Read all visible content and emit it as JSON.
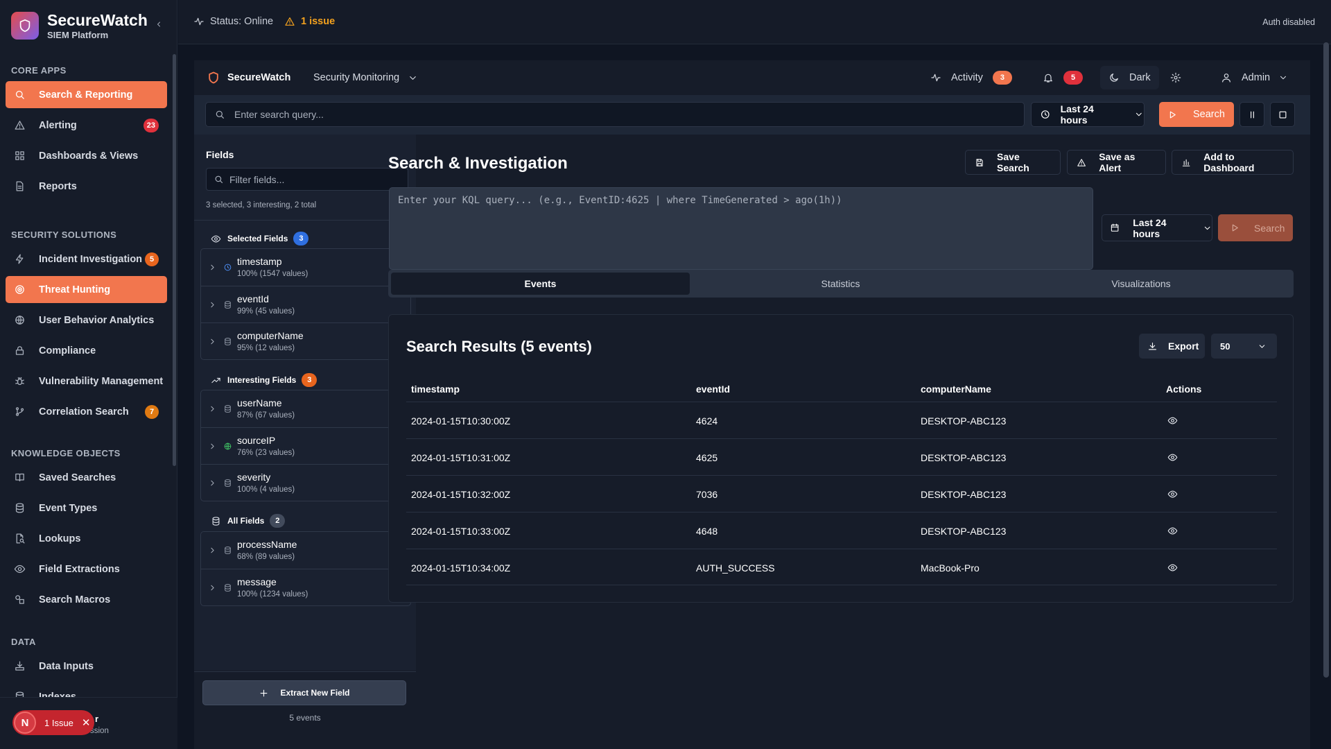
{
  "sidebar": {
    "brand_title": "SecureWatch",
    "brand_subtitle": "SIEM Platform",
    "sections": {
      "core": "CORE APPS",
      "security": "SECURITY SOLUTIONS",
      "knowledge": "KNOWLEDGE OBJECTS",
      "data": "DATA"
    },
    "items": [
      {
        "label": "Search & Reporting",
        "icon": "search-icon"
      },
      {
        "label": "Alerting",
        "icon": "alert-triangle-icon",
        "badge": "23"
      },
      {
        "label": "Dashboards & Views",
        "icon": "grid-icon"
      },
      {
        "label": "Reports",
        "icon": "file-icon"
      },
      {
        "label": "Incident Investigation",
        "icon": "lightning-icon",
        "badge": "5"
      },
      {
        "label": "Threat Hunting",
        "icon": "target-icon"
      },
      {
        "label": "User Behavior Analytics",
        "icon": "globe-icon"
      },
      {
        "label": "Compliance",
        "icon": "lock-icon"
      },
      {
        "label": "Vulnerability Management",
        "icon": "bug-icon"
      },
      {
        "label": "Correlation Search",
        "icon": "branch-icon",
        "badge": "7"
      },
      {
        "label": "Saved Searches",
        "icon": "book-icon"
      },
      {
        "label": "Event Types",
        "icon": "database-icon"
      },
      {
        "label": "Lookups",
        "icon": "file-search-icon"
      },
      {
        "label": "Field Extractions",
        "icon": "eye-icon"
      },
      {
        "label": "Search Macros",
        "icon": "shapes-icon"
      },
      {
        "label": "Data Inputs",
        "icon": "input-icon"
      },
      {
        "label": "Indexes",
        "icon": "database-icon"
      }
    ],
    "user_partial_name": "r",
    "user_partial_role": "ssion",
    "issue_toast": {
      "avatar": "N",
      "text": "1 Issue"
    }
  },
  "topbar": {
    "status": "Status: Online",
    "issue": "1 issue",
    "auth": "Auth disabled"
  },
  "app_header": {
    "title": "SecureWatch",
    "monitor": "Security Monitoring",
    "activity": "Activity",
    "activity_count": "3",
    "notif_count": "5",
    "theme": "Dark",
    "user": "Admin"
  },
  "search_bar": {
    "placeholder": "Enter search query...",
    "time_range": "Last 24 hours",
    "search_label": "Search"
  },
  "fields_panel": {
    "title": "Fields",
    "filter_placeholder": "Filter fields...",
    "summary": "3 selected, 3 interesting, 2 total",
    "groups": {
      "selected": {
        "label": "Selected Fields",
        "count": "3"
      },
      "interesting": {
        "label": "Interesting Fields",
        "count": "3"
      },
      "all": {
        "label": "All Fields",
        "count": "2"
      }
    },
    "selected": [
      {
        "name": "timestamp",
        "stats": "100% (1547 values)"
      },
      {
        "name": "eventId",
        "stats": "99% (45 values)"
      },
      {
        "name": "computerName",
        "stats": "95% (12 values)"
      }
    ],
    "interesting": [
      {
        "name": "userName",
        "stats": "87% (67 values)"
      },
      {
        "name": "sourceIP",
        "stats": "76% (23 values)"
      },
      {
        "name": "severity",
        "stats": "100% (4 values)"
      }
    ],
    "all": [
      {
        "name": "processName",
        "stats": "68% (89 values)"
      },
      {
        "name": "message",
        "stats": "100% (1234 values)"
      }
    ],
    "extract_label": "Extract New Field",
    "event_count": "5 events"
  },
  "main": {
    "title": "Search & Investigation",
    "save_search": "Save Search",
    "save_alert": "Save as Alert",
    "add_dashboard": "Add to Dashboard",
    "kql_placeholder": "Enter your KQL query... (e.g., EventID:4625 | where TimeGenerated > ago(1h))",
    "time_range": "Last 24 hours",
    "search_label": "Search",
    "tabs": [
      "Events",
      "Statistics",
      "Visualizations"
    ],
    "results_title": "Search Results (5 events)",
    "export": "Export",
    "page_size": "50",
    "columns": [
      "timestamp",
      "eventId",
      "computerName",
      "Actions"
    ],
    "rows": [
      [
        "2024-01-15T10:30:00Z",
        "4624",
        "DESKTOP-ABC123"
      ],
      [
        "2024-01-15T10:31:00Z",
        "4625",
        "DESKTOP-ABC123"
      ],
      [
        "2024-01-15T10:32:00Z",
        "7036",
        "DESKTOP-ABC123"
      ],
      [
        "2024-01-15T10:33:00Z",
        "4648",
        "DESKTOP-ABC123"
      ],
      [
        "2024-01-15T10:34:00Z",
        "AUTH_SUCCESS",
        "MacBook-Pro"
      ]
    ]
  },
  "colors": {
    "accent": "#f2764e",
    "background": "#0f1522",
    "panel": "#161c29",
    "danger": "#e0313c",
    "warning": "#f3a11e"
  }
}
